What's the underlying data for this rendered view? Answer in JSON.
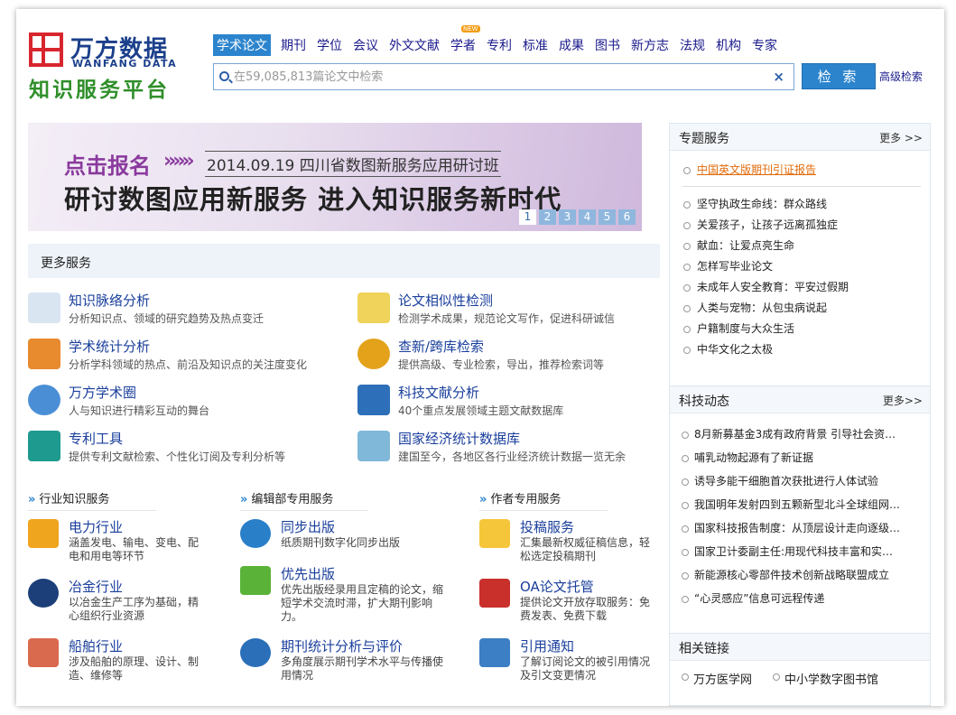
{
  "logo": {
    "cn": "万方数据",
    "en": "WANFANG DATA",
    "subtitle": "知识服务平台"
  },
  "nav": {
    "items": [
      {
        "label": "学术论文",
        "active": true
      },
      {
        "label": "期刊"
      },
      {
        "label": "学位"
      },
      {
        "label": "会议"
      },
      {
        "label": "外文文献"
      },
      {
        "label": "学者",
        "badge": "NEW"
      },
      {
        "label": "专利"
      },
      {
        "label": "标准"
      },
      {
        "label": "成果"
      },
      {
        "label": "图书"
      },
      {
        "label": "新方志"
      },
      {
        "label": "法规"
      },
      {
        "label": "机构"
      },
      {
        "label": "专家"
      }
    ]
  },
  "search": {
    "placeholder": "在59,085,813篇论文中检索",
    "button": "检 索",
    "advanced": "高级检索",
    "clear": "×"
  },
  "banner": {
    "cta": "点击报名",
    "arrows": "»»»",
    "event": "2014.09.19  四川省数图新服务应用研讨班",
    "headline": "研讨数图应用新服务  进入知识服务新时代",
    "pages": [
      "1",
      "2",
      "3",
      "4",
      "5",
      "6"
    ]
  },
  "more_services": {
    "title": "更多服务",
    "items": [
      {
        "title": "知识脉络分析",
        "desc": "分析知识点、领域的研究趋势及热点变迁",
        "icon": "trend-chart-icon",
        "color": "#d9e6f2"
      },
      {
        "title": "论文相似性检测",
        "desc": "检测学术成果，规范论文写作，促进科研诚信",
        "icon": "document-check-icon",
        "color": "#f0d35a"
      },
      {
        "title": "学术统计分析",
        "desc": "分析学科领域的热点、前沿及知识点的关注度变化",
        "icon": "bar-chart-icon",
        "color": "#e88a2e"
      },
      {
        "title": "查新/跨库检索",
        "desc": "提供高级、专业检索，导出，推荐检索词等",
        "icon": "magnifier-plus-icon",
        "color": "#e3a21a"
      },
      {
        "title": "万方学术圈",
        "desc": "人与知识进行精彩互动的舞台",
        "icon": "people-globe-icon",
        "color": "#4a8fd6"
      },
      {
        "title": "科技文献分析",
        "desc": "40个重点发展领域主题文献数据库",
        "icon": "folder-star-icon",
        "color": "#2d6fb8"
      },
      {
        "title": "专利工具",
        "desc": "提供专利文献检索、个性化订阅及专利分析等",
        "icon": "book-icon",
        "color": "#1e9a8e"
      },
      {
        "title": "国家经济统计数据库",
        "desc": "建国至今，各地区各行业经济统计数据一览无余",
        "icon": "data-cube-icon",
        "color": "#7fb8d9"
      }
    ]
  },
  "categories": [
    {
      "title": "行业知识服务",
      "items": [
        {
          "title": "电力行业",
          "desc": "涵盖发电、输电、变电、配电和用电等环节",
          "icon": "power-wave-icon",
          "color": "#f0a51e"
        },
        {
          "title": "冶金行业",
          "desc": "以冶金生产工序为基础，精心组织行业资源",
          "icon": "gears-icon",
          "color": "#1c3f7a"
        },
        {
          "title": "船舶行业",
          "desc": "涉及船舶的原理、设计、制造、维修等",
          "icon": "sailboat-icon",
          "color": "#d96a4e"
        }
      ]
    },
    {
      "title": "编辑部专用服务",
      "items": [
        {
          "title": "同步出版",
          "desc": "纸质期刊数字化同步出版",
          "icon": "sync-publish-icon",
          "color": "#2a7fc9"
        },
        {
          "title": "优先出版",
          "desc": "优先出版经录用且定稿的论文，缩短学术交流时滞，扩大期刊影响力。",
          "icon": "priority-leaf-icon",
          "color": "#5ab338"
        },
        {
          "title": "期刊统计分析与评价",
          "desc": "多角度展示期刊学术水平与传播使用情况",
          "icon": "pie-chart-icon",
          "color": "#2a6fb8"
        }
      ]
    },
    {
      "title": "作者专用服务",
      "items": [
        {
          "title": "投稿服务",
          "desc": "汇集最新权威征稿信息，轻松选定投稿期刊",
          "icon": "sticky-note-icon",
          "color": "#f5c63a"
        },
        {
          "title": "OA论文托管",
          "desc": "提供论文开放存取服务：免费发表、免费下载",
          "icon": "oa-cube-icon",
          "color": "#c9302c"
        },
        {
          "title": "引用通知",
          "desc": "了解订阅论文的被引用情况及引文变更情况",
          "icon": "envelope-icon",
          "color": "#3c7fc4"
        }
      ]
    }
  ],
  "topics": {
    "title": "专题服务",
    "more": "更多 >>",
    "featured": "中国英文版期刊引证报告",
    "items": [
      "坚守执政生命线：群众路线",
      "关爱孩子，让孩子远离孤独症",
      "献血：让爱点亮生命",
      "怎样写毕业论文",
      "未成年人安全教育：平安过假期",
      "人类与宠物：从包虫病说起",
      "户籍制度与大众生活",
      "中华文化之太极"
    ]
  },
  "news": {
    "title": "科技动态",
    "more": "更多>>",
    "items": [
      "8月新募基金3成有政府背景 引导社会资…",
      "哺乳动物起源有了新证据",
      "诱导多能干细胞首次获批进行人体试验",
      "我国明年发射四到五颗新型北斗全球组网…",
      "国家科技报告制度：从顶层设计走向逐级…",
      "国家卫计委副主任:用现代科技丰富和实…",
      "新能源核心零部件技术创新战略联盟成立",
      "“心灵感应”信息可远程传递"
    ]
  },
  "links": {
    "title": "相关链接",
    "items": [
      "万方医学网",
      "中小学数字图书馆"
    ]
  }
}
